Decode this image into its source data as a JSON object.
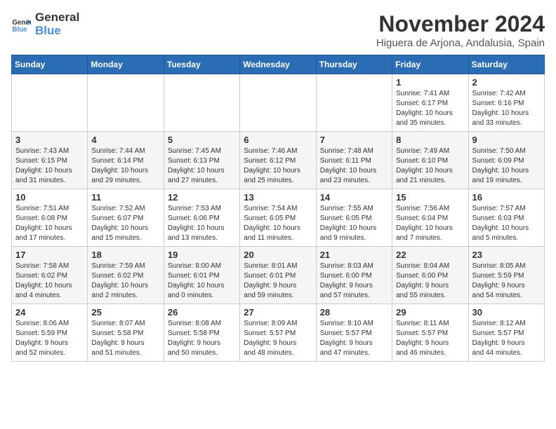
{
  "logo": {
    "text_general": "General",
    "text_blue": "Blue"
  },
  "header": {
    "month": "November 2024",
    "location": "Higuera de Arjona, Andalusia, Spain"
  },
  "weekdays": [
    "Sunday",
    "Monday",
    "Tuesday",
    "Wednesday",
    "Thursday",
    "Friday",
    "Saturday"
  ],
  "weeks": [
    [
      {
        "day": "",
        "info": ""
      },
      {
        "day": "",
        "info": ""
      },
      {
        "day": "",
        "info": ""
      },
      {
        "day": "",
        "info": ""
      },
      {
        "day": "",
        "info": ""
      },
      {
        "day": "1",
        "info": "Sunrise: 7:41 AM\nSunset: 6:17 PM\nDaylight: 10 hours\nand 35 minutes."
      },
      {
        "day": "2",
        "info": "Sunrise: 7:42 AM\nSunset: 6:16 PM\nDaylight: 10 hours\nand 33 minutes."
      }
    ],
    [
      {
        "day": "3",
        "info": "Sunrise: 7:43 AM\nSunset: 6:15 PM\nDaylight: 10 hours\nand 31 minutes."
      },
      {
        "day": "4",
        "info": "Sunrise: 7:44 AM\nSunset: 6:14 PM\nDaylight: 10 hours\nand 29 minutes."
      },
      {
        "day": "5",
        "info": "Sunrise: 7:45 AM\nSunset: 6:13 PM\nDaylight: 10 hours\nand 27 minutes."
      },
      {
        "day": "6",
        "info": "Sunrise: 7:46 AM\nSunset: 6:12 PM\nDaylight: 10 hours\nand 25 minutes."
      },
      {
        "day": "7",
        "info": "Sunrise: 7:48 AM\nSunset: 6:11 PM\nDaylight: 10 hours\nand 23 minutes."
      },
      {
        "day": "8",
        "info": "Sunrise: 7:49 AM\nSunset: 6:10 PM\nDaylight: 10 hours\nand 21 minutes."
      },
      {
        "day": "9",
        "info": "Sunrise: 7:50 AM\nSunset: 6:09 PM\nDaylight: 10 hours\nand 19 minutes."
      }
    ],
    [
      {
        "day": "10",
        "info": "Sunrise: 7:51 AM\nSunset: 6:08 PM\nDaylight: 10 hours\nand 17 minutes."
      },
      {
        "day": "11",
        "info": "Sunrise: 7:52 AM\nSunset: 6:07 PM\nDaylight: 10 hours\nand 15 minutes."
      },
      {
        "day": "12",
        "info": "Sunrise: 7:53 AM\nSunset: 6:06 PM\nDaylight: 10 hours\nand 13 minutes."
      },
      {
        "day": "13",
        "info": "Sunrise: 7:54 AM\nSunset: 6:05 PM\nDaylight: 10 hours\nand 11 minutes."
      },
      {
        "day": "14",
        "info": "Sunrise: 7:55 AM\nSunset: 6:05 PM\nDaylight: 10 hours\nand 9 minutes."
      },
      {
        "day": "15",
        "info": "Sunrise: 7:56 AM\nSunset: 6:04 PM\nDaylight: 10 hours\nand 7 minutes."
      },
      {
        "day": "16",
        "info": "Sunrise: 7:57 AM\nSunset: 6:03 PM\nDaylight: 10 hours\nand 5 minutes."
      }
    ],
    [
      {
        "day": "17",
        "info": "Sunrise: 7:58 AM\nSunset: 6:02 PM\nDaylight: 10 hours\nand 4 minutes."
      },
      {
        "day": "18",
        "info": "Sunrise: 7:59 AM\nSunset: 6:02 PM\nDaylight: 10 hours\nand 2 minutes."
      },
      {
        "day": "19",
        "info": "Sunrise: 8:00 AM\nSunset: 6:01 PM\nDaylight: 10 hours\nand 0 minutes."
      },
      {
        "day": "20",
        "info": "Sunrise: 8:01 AM\nSunset: 6:01 PM\nDaylight: 9 hours\nand 59 minutes."
      },
      {
        "day": "21",
        "info": "Sunrise: 8:03 AM\nSunset: 6:00 PM\nDaylight: 9 hours\nand 57 minutes."
      },
      {
        "day": "22",
        "info": "Sunrise: 8:04 AM\nSunset: 6:00 PM\nDaylight: 9 hours\nand 55 minutes."
      },
      {
        "day": "23",
        "info": "Sunrise: 8:05 AM\nSunset: 5:59 PM\nDaylight: 9 hours\nand 54 minutes."
      }
    ],
    [
      {
        "day": "24",
        "info": "Sunrise: 8:06 AM\nSunset: 5:59 PM\nDaylight: 9 hours\nand 52 minutes."
      },
      {
        "day": "25",
        "info": "Sunrise: 8:07 AM\nSunset: 5:58 PM\nDaylight: 9 hours\nand 51 minutes."
      },
      {
        "day": "26",
        "info": "Sunrise: 8:08 AM\nSunset: 5:58 PM\nDaylight: 9 hours\nand 50 minutes."
      },
      {
        "day": "27",
        "info": "Sunrise: 8:09 AM\nSunset: 5:57 PM\nDaylight: 9 hours\nand 48 minutes."
      },
      {
        "day": "28",
        "info": "Sunrise: 8:10 AM\nSunset: 5:57 PM\nDaylight: 9 hours\nand 47 minutes."
      },
      {
        "day": "29",
        "info": "Sunrise: 8:11 AM\nSunset: 5:57 PM\nDaylight: 9 hours\nand 46 minutes."
      },
      {
        "day": "30",
        "info": "Sunrise: 8:12 AM\nSunset: 5:57 PM\nDaylight: 9 hours\nand 44 minutes."
      }
    ]
  ]
}
